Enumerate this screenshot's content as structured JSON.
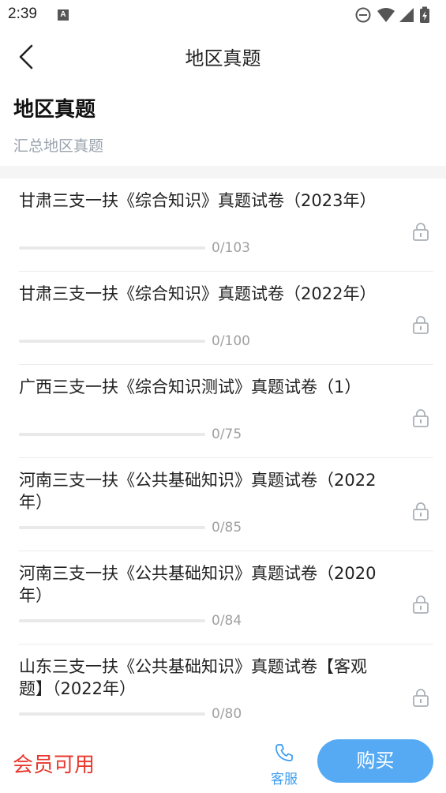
{
  "status_bar": {
    "time": "2:39",
    "notif_letter": "A"
  },
  "nav": {
    "title": "地区真题"
  },
  "header": {
    "title": "地区真题",
    "subtitle": "汇总地区真题"
  },
  "items": [
    {
      "title": "甘肃三支一扶《综合知识》真题试卷（2023年）",
      "progress": "0/103",
      "done": 0,
      "total": 103
    },
    {
      "title": "甘肃三支一扶《综合知识》真题试卷（2022年）",
      "progress": "0/100",
      "done": 0,
      "total": 100
    },
    {
      "title": "广西三支一扶《综合知识测试》真题试卷（1）",
      "progress": "0/75",
      "done": 0,
      "total": 75
    },
    {
      "title": "河南三支一扶《公共基础知识》真题试卷（2022年）",
      "progress": "0/85",
      "done": 0,
      "total": 85
    },
    {
      "title": "河南三支一扶《公共基础知识》真题试卷（2020年）",
      "progress": "0/84",
      "done": 0,
      "total": 84
    },
    {
      "title": "山东三支一扶《公共基础知识》真题试卷【客观题】（2022年）",
      "progress": "0/80",
      "done": 0,
      "total": 80
    }
  ],
  "bottom": {
    "member_text": "会员可用",
    "service_label": "客服",
    "buy_label": "购买"
  },
  "colors": {
    "accent": "#55aaf3",
    "member": "#e8392f",
    "lock": "#a9b0b8"
  },
  "icons": {
    "back": "chevron-left-icon",
    "lock": "lock-icon",
    "phone": "phone-icon"
  }
}
